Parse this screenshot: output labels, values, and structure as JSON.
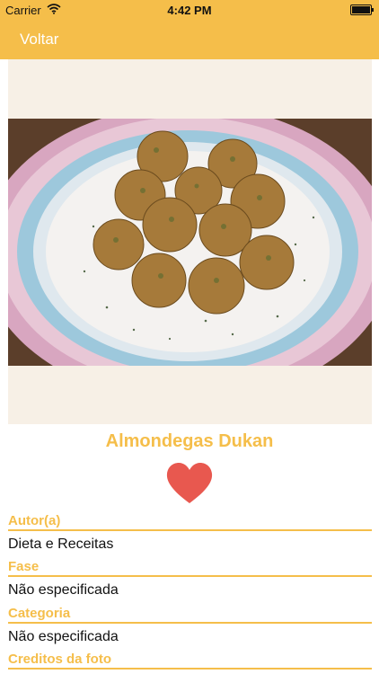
{
  "status_bar": {
    "carrier": "Carrier",
    "time": "4:42 PM"
  },
  "nav": {
    "back_label": "Voltar"
  },
  "recipe": {
    "title": "Almondegas Dukan",
    "favorite_icon": "heart-icon",
    "favorite_color": "#e8584f",
    "fields": [
      {
        "label": "Autor(a)",
        "value": "Dieta e Receitas"
      },
      {
        "label": "Fase",
        "value": "Não especificada"
      },
      {
        "label": "Categoria",
        "value": "Não especificada"
      },
      {
        "label": "Creditos da foto"
      }
    ]
  },
  "colors": {
    "accent": "#f5be4a",
    "photo_background": "#f7f0e6"
  }
}
